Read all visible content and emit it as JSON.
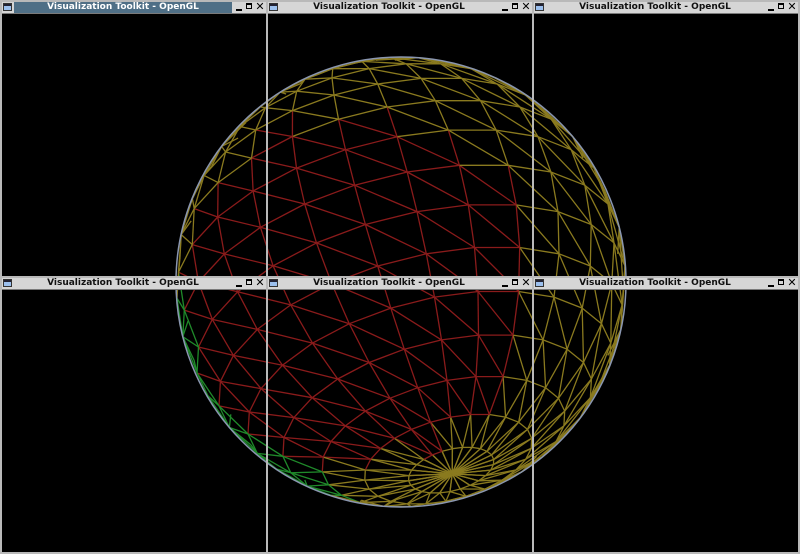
{
  "windows": [
    {
      "title": "Visualization Toolkit - OpenGL",
      "active": true
    },
    {
      "title": "Visualization Toolkit - OpenGL",
      "active": false
    },
    {
      "title": "Visualization Toolkit - OpenGL",
      "active": false
    },
    {
      "title": "Visualization Toolkit - OpenGL",
      "active": false
    },
    {
      "title": "Visualization Toolkit - OpenGL",
      "active": false
    },
    {
      "title": "Visualization Toolkit - OpenGL",
      "active": false
    }
  ],
  "buttons": {
    "close_glyph": "✕"
  },
  "colors": {
    "background": "#000000",
    "titlebar": "#d6d6d6",
    "active_title": "#4f6f86",
    "mesh_red": "#8a1b1b",
    "mesh_yellow": "#8a7a1f",
    "mesh_green": "#1f8a2a",
    "outline": "#8a96b0"
  }
}
